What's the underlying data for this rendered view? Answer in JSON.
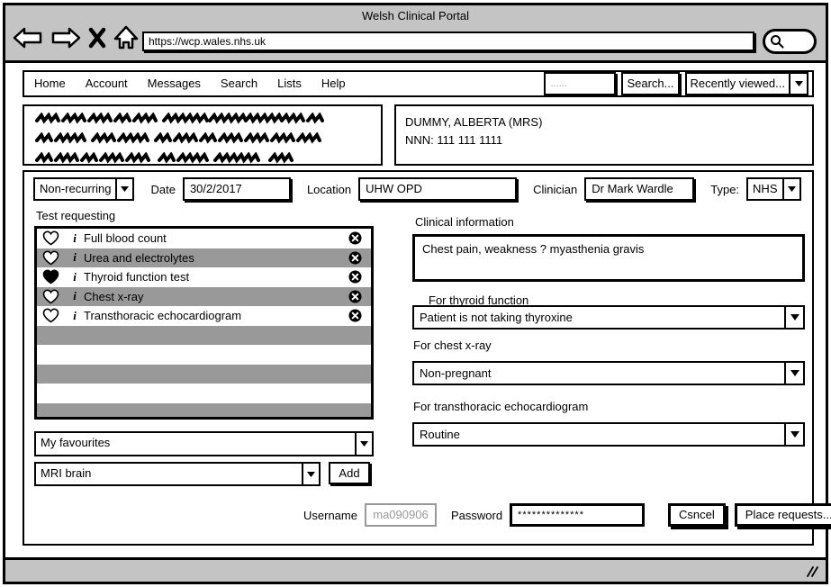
{
  "window": {
    "title": "Welsh Clinical Portal",
    "url": "https://wcp.wales.nhs.uk",
    "nav": {
      "back_icon": "back-arrow-icon",
      "forward_icon": "forward-arrow-icon",
      "stop_icon": "stop-x-icon",
      "home_icon": "home-icon",
      "browser_search_icon": "magnifier-icon"
    }
  },
  "menubar": {
    "items": [
      {
        "label": "Home"
      },
      {
        "label": "Account"
      },
      {
        "label": "Messages"
      },
      {
        "label": "Search"
      },
      {
        "label": "Lists"
      },
      {
        "label": "Help"
      }
    ],
    "quick_search_value": "......",
    "search_button": "Search...",
    "recently_viewed": "Recently viewed..."
  },
  "banner": {
    "notes_placeholder_lines": 3,
    "patient": {
      "name": "DUMMY, ALBERTA (MRS)",
      "nnn": "NNN: 111 111 1111"
    }
  },
  "request": {
    "recurrence": "Non-recurring",
    "date_label": "Date",
    "date_value": "30/2/2017",
    "location_label": "Location",
    "location_value": "UHW OPD",
    "clinician_label": "Clinician",
    "clinician_value": "Dr Mark Wardle",
    "type_label": "Type:",
    "type_value": "NHS"
  },
  "tests": {
    "section_label": "Test requesting",
    "rows": [
      {
        "name": "Full blood count",
        "favourite": false
      },
      {
        "name": "Urea and electrolytes",
        "favourite": false
      },
      {
        "name": "Thyroid function test",
        "favourite": true
      },
      {
        "name": "Chest x-ray",
        "favourite": false
      },
      {
        "name": "Transthoracic echocardiogram",
        "favourite": false
      }
    ],
    "empty_row_count": 5,
    "favourite_icon": "heart-icon",
    "info_icon": "info-icon",
    "delete_icon": "delete-circle-icon"
  },
  "favourites": {
    "list_value": "My favourites",
    "test_value": "MRI brain",
    "add_button": "Add"
  },
  "clinical": {
    "info_label": "Clinical information",
    "info_value": "Chest pain, weakness ? myasthenia gravis",
    "thyroid_label": "For thyroid function",
    "thyroid_value": "Patient is not taking thyroxine",
    "xray_label": "For chest x-ray",
    "xray_value": "Non-pregnant",
    "echo_label": "For transthoracic echocardiogram",
    "echo_value": "Routine"
  },
  "credentials": {
    "username_label": "Username",
    "username_value": "ma090906",
    "password_label": "Password",
    "password_value": "**************",
    "cancel_button": "Csncel",
    "submit_button": "Place requests..."
  },
  "colors": {
    "chrome_gray": "#c4c4c4",
    "row_stripe": "#999999",
    "outline": "#000000",
    "muted_text": "#999999"
  }
}
